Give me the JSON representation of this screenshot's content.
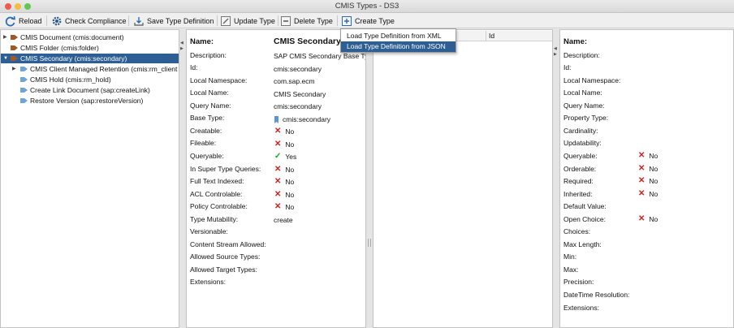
{
  "window": {
    "title": "CMIS Types - DS3"
  },
  "toolbar": {
    "reload": "Reload",
    "check_compliance": "Check Compliance",
    "save_type": "Save Type Definition",
    "update_type": "Update Type",
    "delete_type": "Delete Type",
    "create_type": "Create Type"
  },
  "dropdown": {
    "items": [
      "Load Type Definition from XML",
      "Load Type Definition from JSON"
    ],
    "selected_index": 1
  },
  "tree": {
    "items": [
      {
        "label": "CMIS Document (cmis:document)"
      },
      {
        "label": "CMIS Folder (cmis:folder)"
      },
      {
        "label": "CMIS Secondary (cmis:secondary)"
      },
      {
        "label": "CMIS Client Managed Retention (cmis:rm_client"
      },
      {
        "label": "CMIS Hold (cmis:rm_hold)"
      },
      {
        "label": "Create Link Document (sap:createLink)"
      },
      {
        "label": "Restore Version (sap:restoreVersion)"
      }
    ]
  },
  "type_details": {
    "labels": [
      "Name:",
      "Description:",
      "Id:",
      "Local Namespace:",
      "Local Name:",
      "Query Name:",
      "Base Type:",
      "Creatable:",
      "Fileable:",
      "Queryable:",
      "In Super Type Queries:",
      "Full Text Indexed:",
      "ACL Controlable:",
      "Policy Controlable:",
      "Type Mutability:",
      "Versionable:",
      "Content Stream Allowed:",
      "Allowed Source Types:",
      "Allowed Target Types:",
      "Extensions:"
    ],
    "name": "CMIS Secondary",
    "description": "SAP CMIS Secondary Base Ty",
    "id": "cmis:secondary",
    "local_namespace": "com.sap.ecm",
    "local_name": "CMIS Secondary",
    "query_name": "cmis:secondary",
    "base_type": "cmis:secondary",
    "creatable": "No",
    "fileable": "No",
    "queryable": "Yes",
    "in_super_type_queries": "No",
    "full_text_indexed": "No",
    "acl_controlable": "No",
    "policy_controlable": "No",
    "type_mutability": "create"
  },
  "property_table": {
    "columns": [
      "Id"
    ]
  },
  "property_details": {
    "labels": [
      "Name:",
      "Description:",
      "Id:",
      "Local Namespace:",
      "Local Name:",
      "Query Name:",
      "Property Type:",
      "Cardinality:",
      "Updatability:",
      "Queryable:",
      "Orderable:",
      "Required:",
      "Inherited:",
      "Default Value:",
      "Open Choice:",
      "Choices:",
      "Max Length:",
      "Min:",
      "Max:",
      "Precision:",
      "DateTime Resolution:",
      "Extensions:"
    ],
    "queryable": "No",
    "orderable": "No",
    "required": "No",
    "inherited": "No",
    "open_choice": "No"
  },
  "colors": {
    "selection": "#2e5f94",
    "no": "#d62020",
    "yes": "#1e9e2c"
  }
}
